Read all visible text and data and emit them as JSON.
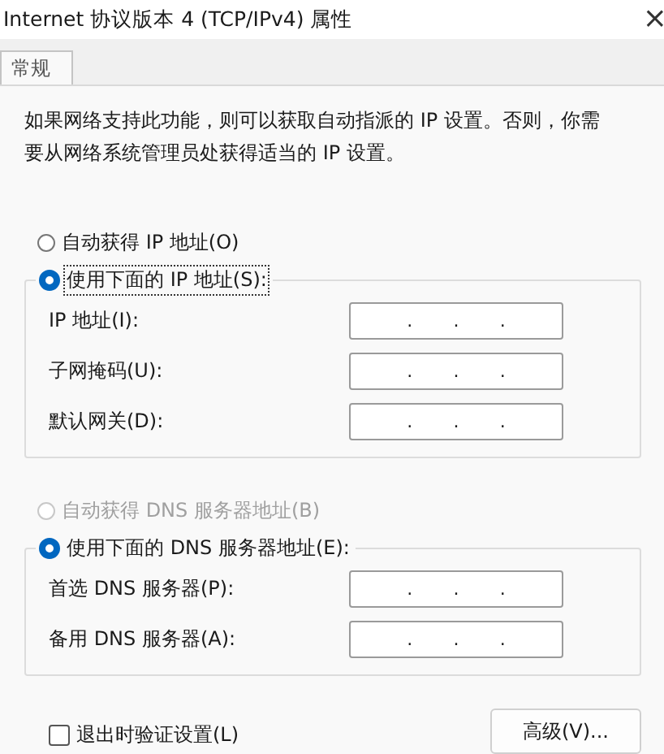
{
  "window": {
    "title": "Internet 协议版本 4 (TCP/IPv4) 属性",
    "close": "×"
  },
  "tabs": [
    {
      "label": "常规",
      "selected": true
    }
  ],
  "description": "如果网络支持此功能，则可以获取自动指派的 IP 设置。否则，你需要从网络系统管理员处获得适当的 IP 设置。",
  "ip_options": [
    {
      "label": "自动获得 IP 地址(O)",
      "selected": false,
      "disabled": false,
      "focused": false
    },
    {
      "label": "使用下面的 IP 地址(S):",
      "selected": true,
      "disabled": false,
      "focused": true
    }
  ],
  "ip_fields": [
    {
      "label": "IP 地址(I):",
      "separators": [
        ".",
        ".",
        "."
      ]
    },
    {
      "label": "子网掩码(U):",
      "separators": [
        ".",
        ".",
        "."
      ]
    },
    {
      "label": "默认网关(D):",
      "separators": [
        ".",
        ".",
        "."
      ]
    }
  ],
  "dns_options": [
    {
      "label": "自动获得 DNS 服务器地址(B)",
      "selected": false,
      "disabled": true,
      "focused": false
    },
    {
      "label": "使用下面的 DNS 服务器地址(E):",
      "selected": true,
      "disabled": false,
      "focused": false
    }
  ],
  "dns_fields": [
    {
      "label": "首选 DNS 服务器(P):",
      "separators": [
        ".",
        ".",
        "."
      ]
    },
    {
      "label": "备用 DNS 服务器(A):",
      "separators": [
        ".",
        ".",
        "."
      ]
    }
  ],
  "validate_on_exit": {
    "label": "退出时验证设置(L)",
    "checked": false
  },
  "advanced_button": "高级(V)..."
}
